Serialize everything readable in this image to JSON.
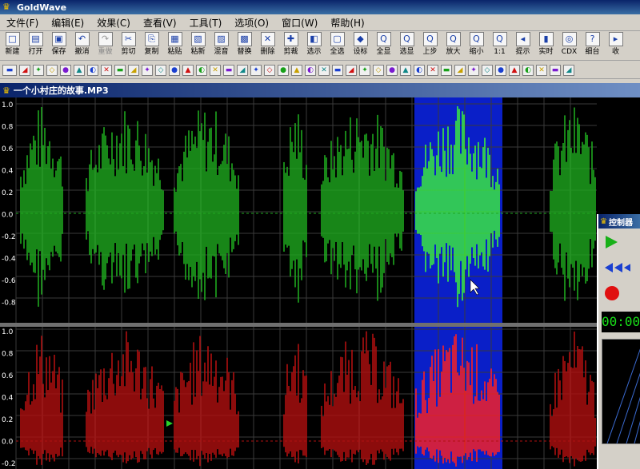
{
  "app": {
    "title": "GoldWave",
    "logo_icon": "goldwave-crown-icon"
  },
  "menu": [
    "文件(F)",
    "编辑(E)",
    "效果(C)",
    "查看(V)",
    "工具(T)",
    "选项(O)",
    "窗口(W)",
    "帮助(H)"
  ],
  "toolbar": [
    {
      "label": "新建",
      "icon": "new-icon",
      "enabled": true
    },
    {
      "label": "打开",
      "icon": "open-icon",
      "enabled": true
    },
    {
      "label": "保存",
      "icon": "save-icon",
      "enabled": true
    },
    {
      "label": "撤消",
      "icon": "undo-icon",
      "enabled": true
    },
    {
      "label": "重做",
      "icon": "redo-icon",
      "enabled": false
    },
    {
      "label": "剪切",
      "icon": "cut-icon",
      "enabled": true
    },
    {
      "label": "复制",
      "icon": "copy-icon",
      "enabled": true
    },
    {
      "label": "粘贴",
      "icon": "paste-icon",
      "enabled": true
    },
    {
      "label": "粘新",
      "icon": "paste-new-icon",
      "enabled": true
    },
    {
      "label": "混音",
      "icon": "mix-icon",
      "enabled": true
    },
    {
      "label": "替换",
      "icon": "replace-icon",
      "enabled": true
    },
    {
      "label": "删除",
      "icon": "delete-icon",
      "enabled": true
    },
    {
      "label": "剪裁",
      "icon": "trim-icon",
      "enabled": true
    },
    {
      "label": "选示",
      "icon": "select-view-icon",
      "enabled": true
    },
    {
      "label": "全选",
      "icon": "select-all-icon",
      "enabled": true
    },
    {
      "label": "设标",
      "icon": "set-marker-icon",
      "enabled": true
    },
    {
      "label": "全显",
      "icon": "show-all-icon",
      "enabled": true
    },
    {
      "label": "选显",
      "icon": "zoom-selection-icon",
      "enabled": true
    },
    {
      "label": "上步",
      "icon": "zoom-previous-icon",
      "enabled": true
    },
    {
      "label": "放大",
      "icon": "zoom-in-icon",
      "enabled": true
    },
    {
      "label": "缩小",
      "icon": "zoom-out-icon",
      "enabled": true
    },
    {
      "label": "1:1",
      "icon": "zoom-1-1-icon",
      "enabled": true
    },
    {
      "label": "提示",
      "icon": "cue-icon",
      "enabled": true
    },
    {
      "label": "实时",
      "icon": "realtime-icon",
      "enabled": true
    },
    {
      "label": "CDX",
      "icon": "cd-extract-icon",
      "enabled": true
    },
    {
      "label": "细台",
      "icon": "help-icon",
      "enabled": true
    },
    {
      "label": "收",
      "icon": "collapse-icon",
      "enabled": true
    }
  ],
  "toolbar2_icons": [
    "line-tool",
    "effect-1",
    "effect-2",
    "effect-3",
    "effect-4",
    "effect-5",
    "effect-6",
    "effect-7",
    "effect-8",
    "effect-9",
    "effect-10",
    "effect-11",
    "effect-12",
    "effect-13",
    "effect-14",
    "effect-15",
    "effect-16",
    "effect-17",
    "effect-18",
    "effect-19",
    "effect-20",
    "effect-21",
    "effect-22",
    "effect-23",
    "effect-24",
    "effect-25",
    "effect-26",
    "effect-27",
    "effect-28",
    "effect-29",
    "effect-30",
    "effect-31",
    "effect-32",
    "effect-33",
    "effect-34",
    "effect-35",
    "effect-36",
    "effect-37",
    "effect-38",
    "effect-39",
    "effect-40",
    "effect-41"
  ],
  "document": {
    "title": "一个小村庄的故事.MP3"
  },
  "waveform": {
    "y_ticks_top": [
      "1.0",
      "0.8",
      "0.6",
      "0.4",
      "0.2",
      "0.0",
      "-0.2",
      "-0.4",
      "-0.6",
      "-0.8"
    ],
    "y_ticks_bottom": [
      "1.0",
      "0.8",
      "0.6",
      "0.4",
      "0.2",
      "0.0",
      "-0.2"
    ],
    "left_channel_color": "#1fa81f",
    "right_channel_color": "#b01010",
    "selection_color": "#0a1fc8",
    "selected_left_color": "#3cf03c",
    "selected_right_color": "#ff2020"
  },
  "control": {
    "title": "控制器",
    "play_icon": "play-icon",
    "rewind_icon": "rewind-icon",
    "record_icon": "record-icon",
    "time": "00:00"
  }
}
